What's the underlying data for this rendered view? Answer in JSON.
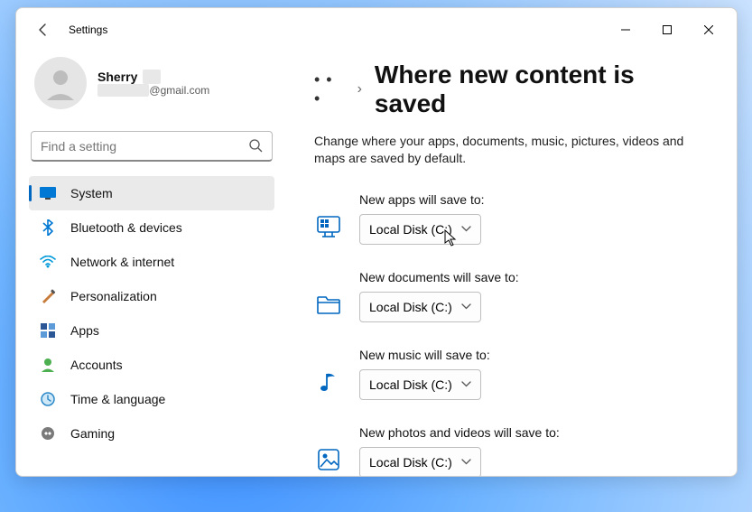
{
  "window": {
    "title": "Settings"
  },
  "profile": {
    "name": "Sherry",
    "email_hidden": "________",
    "email_suffix": "@gmail.com"
  },
  "search": {
    "placeholder": "Find a setting"
  },
  "nav": [
    {
      "label": "System",
      "selected": true
    },
    {
      "label": "Bluetooth & devices"
    },
    {
      "label": "Network & internet"
    },
    {
      "label": "Personalization"
    },
    {
      "label": "Apps"
    },
    {
      "label": "Accounts"
    },
    {
      "label": "Time & language"
    },
    {
      "label": "Gaming"
    }
  ],
  "breadcrumb": {
    "ellipsis": "• • •",
    "chevron": "›"
  },
  "page": {
    "title": "Where new content is saved",
    "description": "Change where your apps, documents, music, pictures, videos and maps are saved by default."
  },
  "settings": [
    {
      "label": "New apps will save to:",
      "value": "Local Disk (C:)"
    },
    {
      "label": "New documents will save to:",
      "value": "Local Disk (C:)"
    },
    {
      "label": "New music will save to:",
      "value": "Local Disk (C:)"
    },
    {
      "label": "New photos and videos will save to:",
      "value": "Local Disk (C:)"
    }
  ]
}
